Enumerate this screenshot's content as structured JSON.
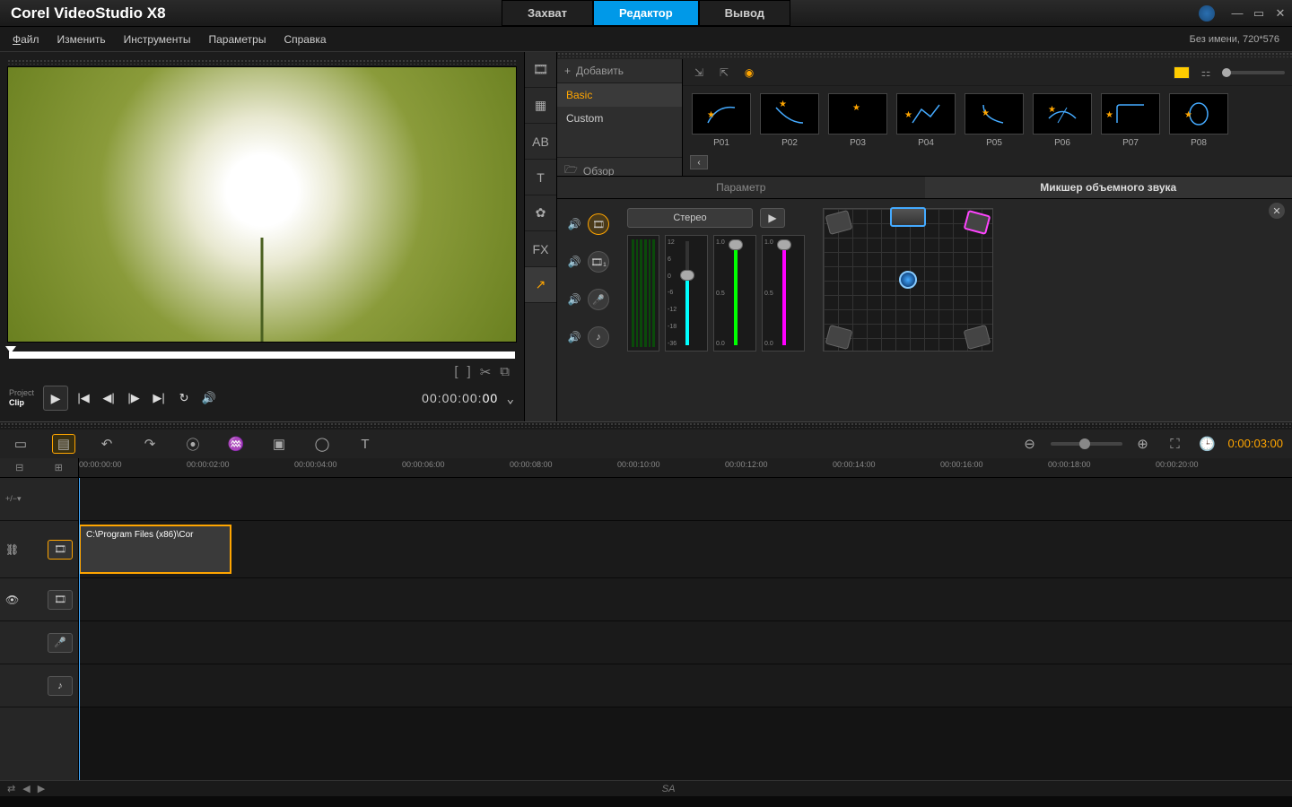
{
  "app": {
    "title": "Corel VideoStudio X8"
  },
  "main_tabs": {
    "capture": "Захват",
    "editor": "Редактор",
    "output": "Вывод"
  },
  "menu": {
    "file": "Файл",
    "edit": "Изменить",
    "tools": "Инструменты",
    "params": "Параметры",
    "help": "Справка",
    "status": "Без имени, 720*576"
  },
  "preview": {
    "mode_project": "Project",
    "mode_clip": "Clip",
    "timecode": "00:00:00:00",
    "timecode_prefix": "00:00:00:",
    "timecode_frames": "00"
  },
  "library": {
    "add": "Добавить",
    "categories": [
      "Basic",
      "Custom"
    ],
    "browse": "Обзор",
    "presets": [
      "P01",
      "P02",
      "P03",
      "P04",
      "P05",
      "P06",
      "P07",
      "P08"
    ]
  },
  "mixer": {
    "tab_param": "Параметр",
    "tab_mixer": "Микшер объемного звука",
    "stereo": "Стерео",
    "scale": [
      "12",
      "6",
      "0",
      "-6",
      "-12",
      "-18",
      "-36"
    ],
    "fader_scale": [
      "1.0",
      "0.5",
      "0.0"
    ]
  },
  "timeline": {
    "timecode": "0:00:03:00",
    "ruler": [
      "00:00:00:00",
      "00:00:02:00",
      "00:00:04:00",
      "00:00:06:00",
      "00:00:08:00",
      "00:00:10:00",
      "00:00:12:00",
      "00:00:14:00",
      "00:00:16:00",
      "00:00:18:00",
      "00:00:20:00"
    ],
    "clip_label": "C:\\Program Files (x86)\\Cor"
  },
  "statusbar": {
    "center": "SA"
  }
}
